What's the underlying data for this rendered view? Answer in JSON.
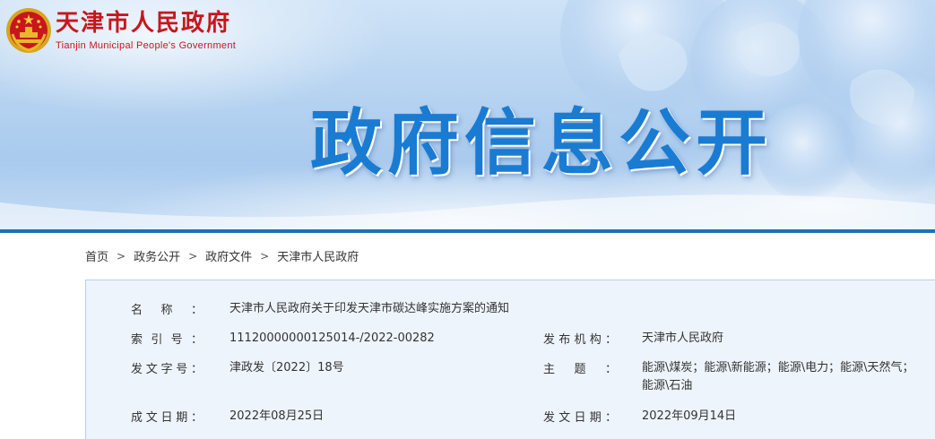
{
  "header": {
    "site_name_cn": "天津市人民政府",
    "site_name_en": "Tianjin Municipal People's Government",
    "banner_title": "政府信息公开",
    "brand_red": "#c8161d",
    "title_blue": "#1a7bd2",
    "logo_icon": "national-emblem-icon"
  },
  "breadcrumb": {
    "items": [
      "首页",
      "政务公开",
      "政府文件",
      "天津市人民政府"
    ],
    "separator": ">"
  },
  "info": {
    "name_label": "名　称：",
    "name_value": "天津市人民政府关于印发天津市碳达峰实施方案的通知",
    "index_label": "索引号：",
    "index_value": "11120000000125014-/2022-00282",
    "issuer_label": "发布机构：",
    "issuer_value": "天津市人民政府",
    "doc_no_label": "发文字号：",
    "doc_no_value": "津政发〔2022〕18号",
    "topic_label": "主　题：",
    "topic_value": "能源\\煤炭；能源\\新能源；能源\\电力；能源\\天然气；能源\\石油",
    "created_label": "成文日期：",
    "created_value": "2022年08月25日",
    "published_label": "发文日期：",
    "published_value": "2022年09月14日"
  }
}
